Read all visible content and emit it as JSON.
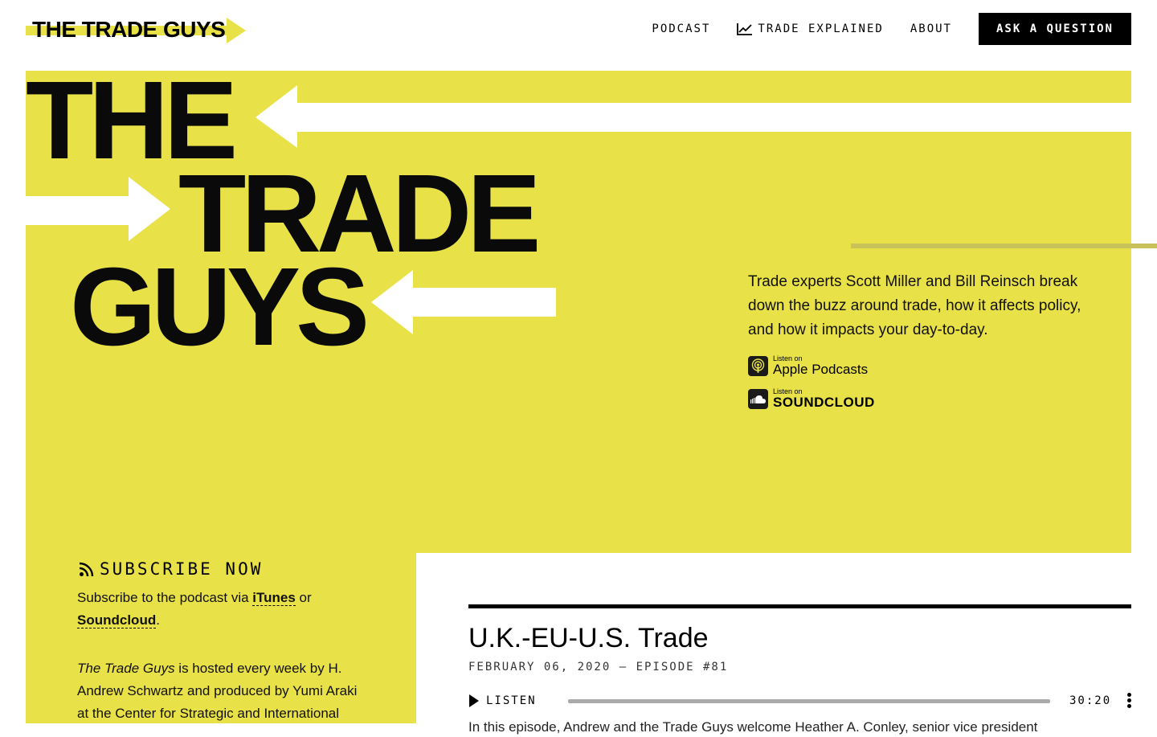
{
  "header": {
    "logo_text": "THE TRADE GUYS",
    "nav": [
      {
        "label": "PODCAST",
        "icon": null
      },
      {
        "label": "TRADE EXPLAINED",
        "icon": "chart-line-icon"
      },
      {
        "label": "ABOUT",
        "icon": null
      }
    ],
    "cta_label": "ASK A QUESTION"
  },
  "hero": {
    "title_lines": [
      "THE",
      "TRADE",
      "GUYS"
    ],
    "description": "Trade experts Scott Miller and Bill Reinsch break down the buzz around trade, how it affects policy, and how it impacts your day-to-day.",
    "badges": [
      {
        "small": "Listen on",
        "big": "Apple Podcasts",
        "icon": "apple-podcasts-icon"
      },
      {
        "small": "Listen on",
        "big": "SOUNDCLOUD",
        "icon": "soundcloud-icon"
      }
    ]
  },
  "subscribe": {
    "title": "SUBSCRIBE NOW",
    "text_before": "Subscribe to the podcast via ",
    "itunes": "iTunes",
    "text_or": " or ",
    "soundcloud": "Soundcloud",
    "text_end": ".",
    "about_italic": "The Trade Guys",
    "about_rest": " is hosted every week by H. Andrew Schwartz and produced by Yumi Araki at the Center for Strategic and International"
  },
  "episode": {
    "title": "U.K.-EU-U.S. Trade",
    "meta": "FEBRUARY 06, 2020 — EPISODE #81",
    "listen_label": "LISTEN",
    "duration": "30:20",
    "progress": 0,
    "excerpt": "In this episode, Andrew and the Trade Guys welcome Heather A. Conley, senior vice president"
  },
  "colors": {
    "accent_yellow": "#e8e147",
    "black": "#000000",
    "white": "#ffffff"
  }
}
